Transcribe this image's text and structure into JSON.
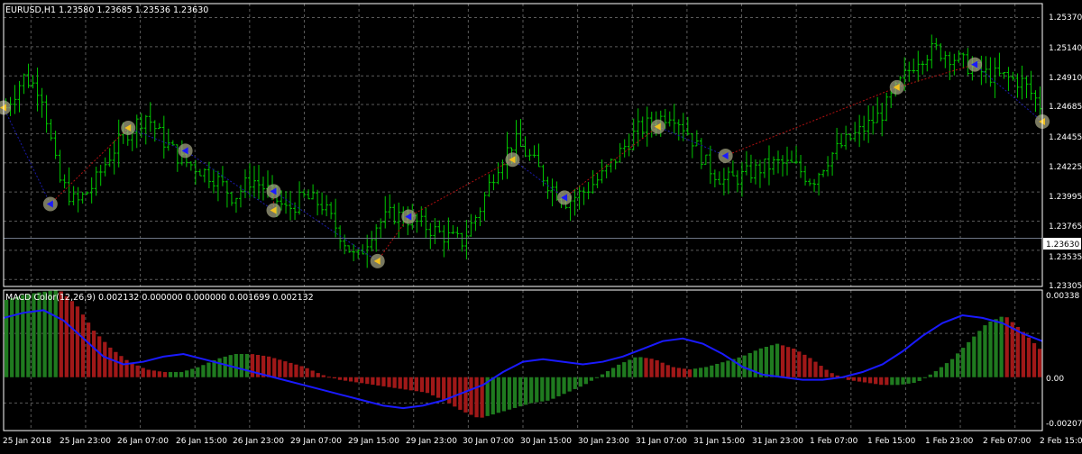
{
  "colors": {
    "background": "#000000",
    "grid": "#5a5a5a",
    "axis": "#ffffff",
    "price_bar": "#00c800",
    "macd_up": "#1f7a1f",
    "macd_down": "#a01818",
    "signal": "#1a1aff",
    "zigzag_up": "#b01010",
    "zigzag_down": "#1a1aa8",
    "marker_halo": "#a0a080",
    "current_price_line": "#6d7585"
  },
  "header": {
    "title": "EURUSD,H1  1.23580 1.23685 1.23536 1.23630"
  },
  "price_axis": {
    "labels": [
      "1.25370",
      "1.25140",
      "1.24910",
      "1.24685",
      "1.24455",
      "1.24225",
      "1.23995",
      "1.23765",
      "1.23535",
      "1.23305"
    ],
    "current_price_label": "1.23630"
  },
  "macd_panel": {
    "title": "MACD Color(12,26,9) 0.002132 0.000000 0.000000 0.001699 0.002132",
    "axis_labels": [
      "0.00338",
      "0.00",
      "-0.00207"
    ]
  },
  "time_axis": {
    "labels": [
      "25 Jan 2018",
      "25 Jan 23:00",
      "26 Jan 07:00",
      "26 Jan 15:00",
      "26 Jan 23:00",
      "29 Jan 07:00",
      "29 Jan 15:00",
      "29 Jan 23:00",
      "30 Jan 07:00",
      "30 Jan 15:00",
      "30 Jan 23:00",
      "31 Jan 07:00",
      "31 Jan 15:00",
      "31 Jan 23:00",
      "1 Feb 07:00",
      "1 Feb 15:00",
      "1 Feb 23:00",
      "2 Feb 07:00",
      "2 Feb 15:00"
    ]
  },
  "chart_data": [
    {
      "type": "line",
      "title": "EURUSD,H1  1.23580 1.23685 1.23536 1.23630",
      "ylim": [
        1.2325,
        1.2548
      ],
      "current_price": 1.2363,
      "categories": [
        "25 Jan 2018",
        "25 Jan 23:00",
        "26 Jan 07:00",
        "26 Jan 15:00",
        "26 Jan 23:00",
        "29 Jan 07:00",
        "29 Jan 15:00",
        "29 Jan 23:00",
        "30 Jan 07:00",
        "30 Jan 15:00",
        "30 Jan 23:00",
        "31 Jan 07:00",
        "31 Jan 15:00",
        "31 Jan 23:00",
        "1 Feb 07:00",
        "1 Feb 15:00",
        "1 Feb 23:00",
        "2 Feb 07:00",
        "2 Feb 15:00"
      ],
      "close_path": [
        1.2466,
        1.249,
        1.248,
        1.241,
        1.239,
        1.2405,
        1.243,
        1.2448,
        1.246,
        1.244,
        1.2425,
        1.2418,
        1.241,
        1.2395,
        1.241,
        1.24,
        1.2385,
        1.2395,
        1.239,
        1.2368,
        1.2345,
        1.2372,
        1.2382,
        1.2378,
        1.2372,
        1.2365,
        1.236,
        1.2385,
        1.242,
        1.244,
        1.2425,
        1.2405,
        1.2392,
        1.24,
        1.2412,
        1.243,
        1.2448,
        1.2455,
        1.2463,
        1.2445,
        1.242,
        1.2408,
        1.2412,
        1.2418,
        1.2422,
        1.242,
        1.2408,
        1.2428,
        1.244,
        1.245,
        1.2462,
        1.2485,
        1.2505,
        1.2512,
        1.2506,
        1.2498,
        1.2492,
        1.249,
        1.2486,
        1.2468
      ]
    },
    {
      "type": "bar",
      "title": "MACD Color(12,26,9) 0.002132 0.000000 0.000000 0.001699 0.002132",
      "ylim": [
        -0.00207,
        0.00338
      ],
      "ticks": [
        0.00338,
        0,
        -0.00207
      ],
      "histogram": [
        0.003,
        0.0032,
        0.0033,
        0.0034,
        0.0028,
        0.0018,
        0.0011,
        0.0006,
        0.0003,
        0.0002,
        0.0002,
        0.0004,
        0.0007,
        0.0009,
        0.0009,
        0.0008,
        0.0006,
        0.0004,
        0.0001,
        -0.0001,
        -0.0002,
        -0.0003,
        -0.0004,
        -0.0005,
        -0.0006,
        -0.0009,
        -0.0013,
        -0.0016,
        -0.0014,
        -0.0012,
        -0.001,
        -0.0009,
        -0.0006,
        -0.0003,
        0.0001,
        0.0005,
        0.0008,
        0.0007,
        0.0004,
        0.0003,
        0.0004,
        0.0006,
        0.0008,
        0.0011,
        0.0013,
        0.0011,
        0.0007,
        0.0002,
        -0.0001,
        -0.0002,
        -0.0003,
        -0.0003,
        -0.0002,
        0.0002,
        0.0007,
        0.0014,
        0.0021,
        0.0024,
        0.0018,
        0.0011
      ],
      "signal": [
        0.0023,
        0.0025,
        0.0026,
        0.0022,
        0.0015,
        0.0008,
        0.0005,
        0.0006,
        0.0008,
        0.0009,
        0.0007,
        0.0005,
        0.0003,
        0.0001,
        -0.0001,
        -0.0003,
        -0.0005,
        -0.0007,
        -0.0009,
        -0.0011,
        -0.0012,
        -0.0011,
        -0.0009,
        -0.0006,
        -0.0003,
        0.0002,
        0.0006,
        0.0007,
        0.0006,
        0.0005,
        0.0006,
        0.0008,
        0.0011,
        0.0014,
        0.0015,
        0.0013,
        0.0009,
        0.0004,
        0.0001,
        0.0,
        -0.0001,
        -0.0001,
        0.0,
        0.0002,
        0.0005,
        0.001,
        0.0016,
        0.0021,
        0.0024,
        0.0023,
        0.0021,
        0.0017,
        0.0014
      ]
    }
  ]
}
